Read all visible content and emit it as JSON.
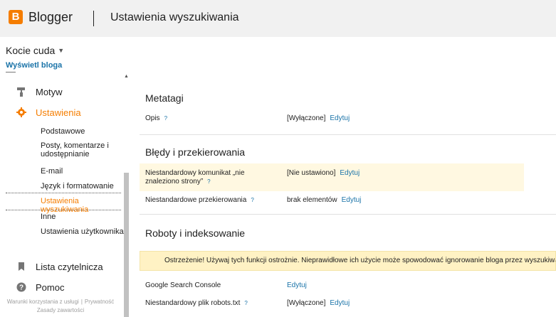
{
  "header": {
    "logo_letter": "B",
    "brand": "Blogger",
    "page_title": "Ustawienia wyszukiwania"
  },
  "sidebar": {
    "blog_name": "Kocie cuda",
    "view_blog": "Wyświetl bloga",
    "items": [
      {
        "label": "Motyw",
        "icon": "paint-roller-icon"
      },
      {
        "label": "Ustawienia",
        "icon": "gear-icon",
        "active": true
      },
      {
        "label": "Lista czytelnicza",
        "icon": "bookmark-icon"
      },
      {
        "label": "Pomoc",
        "icon": "help-icon"
      }
    ],
    "sub_items": [
      {
        "label": "Podstawowe"
      },
      {
        "label": "Posty, komentarze i udostępnianie"
      },
      {
        "label": "E-mail"
      },
      {
        "label": "Język i formatowanie"
      },
      {
        "label": "Ustawienia wyszukiwania",
        "active": true
      },
      {
        "label": "Inne"
      },
      {
        "label": "Ustawienia użytkownika"
      }
    ],
    "footer": {
      "terms": "Warunki korzystania z usługi",
      "privacy": "Prywatność",
      "content_policy": "Zasady zawartości"
    }
  },
  "colors": {
    "accent": "#f57d00",
    "link": "#1a73a8",
    "warning_bg": "#fff2c4",
    "highlight_bg": "#fff8e1"
  },
  "main": {
    "metatags": {
      "title": "Metatagi",
      "rows": [
        {
          "label": "Opis",
          "help": "?",
          "value": "[Wyłączone]",
          "edit": "Edytuj"
        }
      ]
    },
    "errors": {
      "title": "Błędy i przekierowania",
      "rows": [
        {
          "label": "Niestandardowy komunikat „nie znaleziono strony”",
          "help": "?",
          "value": "[Nie ustawiono]",
          "edit": "Edytuj"
        },
        {
          "label": "Niestandardowe przekierowania",
          "help": "?",
          "value": "brak elementów",
          "edit": "Edytuj"
        }
      ]
    },
    "robots": {
      "title": "Roboty i indeksowanie",
      "warning": "Ostrzeżenie! Używaj tych funkcji ostrożnie. Nieprawidłowe ich użycie może spowodować ignorowanie bloga przez wyszukiwarki.",
      "rows": [
        {
          "label": "Google Search Console",
          "edit": "Edytuj"
        },
        {
          "label": "Niestandardowy plik robots.txt",
          "help": "?",
          "value": "[Wyłączone]",
          "edit": "Edytuj"
        }
      ]
    }
  }
}
